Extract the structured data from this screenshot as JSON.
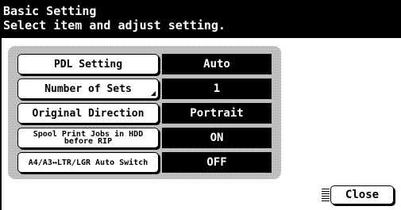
{
  "header": {
    "title": "Basic Setting",
    "subtitle": "Select item and adjust setting."
  },
  "settings": [
    {
      "label": "PDL Setting",
      "value": "Auto"
    },
    {
      "label": "Number of Sets",
      "value": "1"
    },
    {
      "label": "Original Direction",
      "value": "Portrait"
    },
    {
      "label": "Spool Print Jobs in HDD before RIP",
      "value": "ON"
    },
    {
      "label": "A4/A3↔LTR/LGR Auto Switch",
      "value": "OFF"
    }
  ],
  "footer": {
    "close_label": "Close"
  },
  "colors": {
    "header_bg": "#000000",
    "header_text": "#ffffff",
    "panel_bg": "#c8c8c8",
    "value_bg": "#000000",
    "value_text": "#ffffff"
  }
}
